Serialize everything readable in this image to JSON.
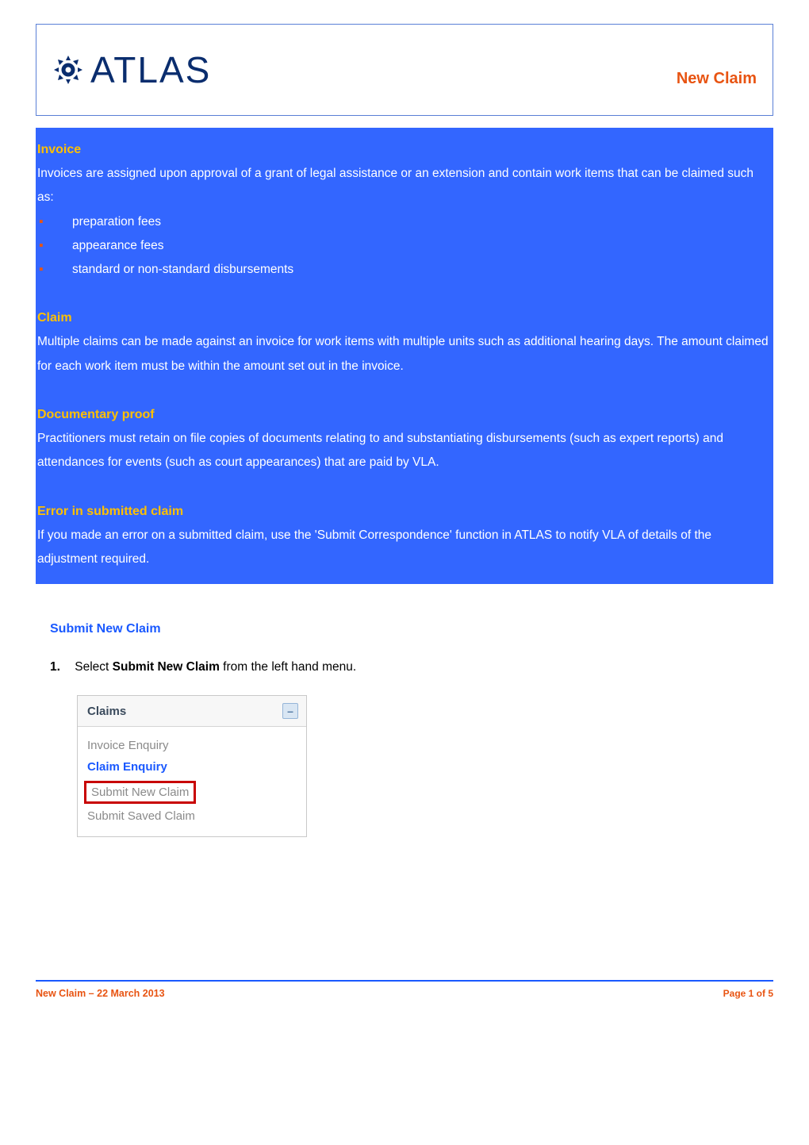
{
  "header": {
    "logo_text": "ATLAS",
    "title": "New Claim"
  },
  "info_panel": {
    "invoice": {
      "heading": "Invoice",
      "intro": "Invoices are assigned upon approval of a grant of legal assistance or an extension and contain work items that can be claimed such as:",
      "items": [
        "preparation fees",
        "appearance fees",
        "standard or non-standard disbursements"
      ]
    },
    "claim": {
      "heading": "Claim",
      "text": "Multiple claims can be made against an invoice for work items with multiple units such as additional hearing days. The amount claimed for each work item must be within the amount set out in the invoice."
    },
    "documentary_proof": {
      "heading": "Documentary proof",
      "text": "Practitioners must retain on file copies of documents relating to and substantiating disbursements (such as expert reports) and attendances for events (such as court appearances) that are paid by VLA."
    },
    "error": {
      "heading": "Error in submitted claim",
      "text": "If you made an error on a submitted claim, use the 'Submit Correspondence' function in ATLAS to notify VLA of details of the adjustment required."
    }
  },
  "section_title": "Submit New Claim",
  "step1": {
    "number": "1.",
    "prefix": "Select ",
    "bold": "Submit New Claim",
    "suffix": " from the left hand menu."
  },
  "menu": {
    "header": "Claims",
    "items": {
      "invoice_enquiry": "Invoice Enquiry",
      "claim_enquiry": "Claim Enquiry",
      "submit_new_claim": "Submit New Claim",
      "submit_saved_claim": "Submit Saved Claim"
    }
  },
  "footer": {
    "left": "New Claim – 22 March 2013",
    "right": "Page 1 of 5"
  }
}
